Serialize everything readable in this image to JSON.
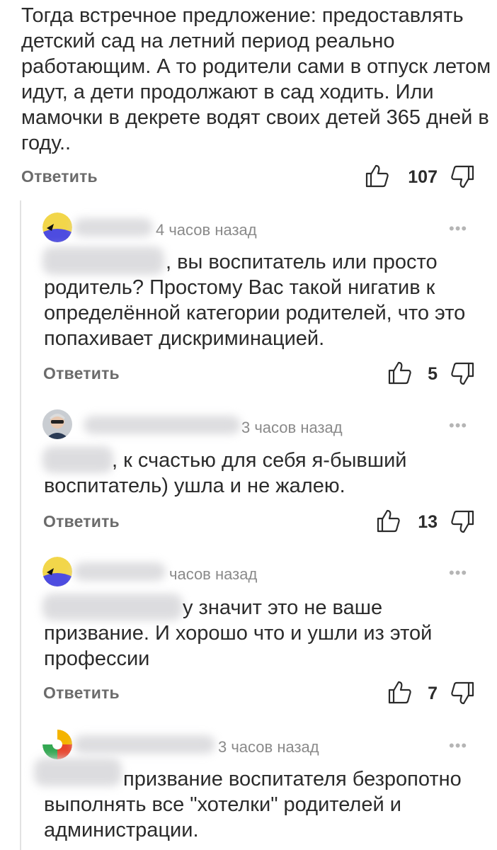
{
  "top_comment": {
    "text": "Тогда встречное предложение: предоставлять детский сад на летний период реально работающим. А то родители сами в отпуск летом идут, а дети продолжают в сад ходить. Или мамочки в декрете водят своих детей 365 дней в году..",
    "reply_label": "Ответить",
    "likes": "107"
  },
  "replies": [
    {
      "time": "4 часов назад",
      "text_visible": ", вы воспитатель или просто родитель? Простому Вас такой нигатив к определённой категории родителей, что это попахивает дискриминацией.",
      "reply_label": "Ответить",
      "likes": "5",
      "avatar_icon": "yellow-blue-avatar-icon"
    },
    {
      "time": "3 часов назад",
      "text_visible": ", к счастью для себя я-бывший воспитатель) ушла и не жалею.",
      "reply_label": "Ответить",
      "likes": "13",
      "avatar_icon": "photo-avatar-icon"
    },
    {
      "time": "часов назад",
      "text_visible": "у значит это не ваше призвание. И хорошо что и ушли из этой профессии",
      "reply_label": "Ответить",
      "likes": "7",
      "avatar_icon": "yellow-blue-avatar-icon"
    },
    {
      "time": "3 часов назад",
      "text_visible": "призвание воспитателя безропотно выполнять все \"хотелки\" родителей и администрации.",
      "avatar_icon": "multicolor-avatar-icon"
    }
  ],
  "more_symbol": "•••",
  "icons": {
    "like": "thumb-up-icon",
    "dislike": "thumb-down-icon"
  }
}
